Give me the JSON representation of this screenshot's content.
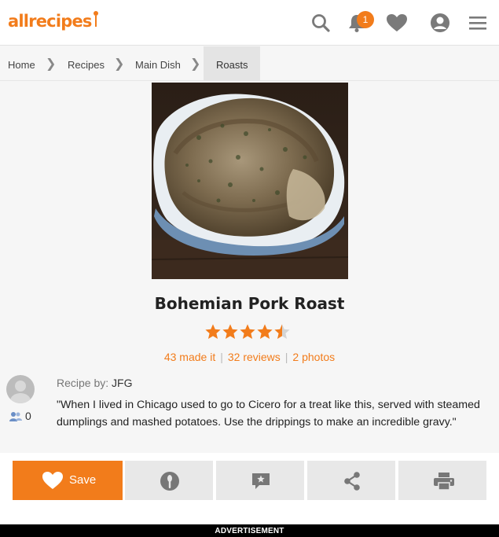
{
  "header": {
    "logo_text": "allrecipes",
    "notification_count": "1",
    "icons": [
      "search-icon",
      "bell-icon",
      "heart-icon",
      "user-icon",
      "menu-icon"
    ],
    "accent_color": "#f27c1b"
  },
  "breadcrumbs": [
    "Home",
    "Recipes",
    "Main Dish",
    "Roasts"
  ],
  "recipe": {
    "title": "Bohemian Pork Roast",
    "rating": 4.5,
    "made_it": "43 made it",
    "reviews": "32 reviews",
    "photos": "2 photos",
    "byline_label": "Recipe by:",
    "author": "JFG",
    "followers": "0",
    "description": "\"When I lived in Chicago used to go to Cicero for a treat like this, served with steamed dumplings and mashed potatoes. Use the drippings to make an incredible gravy.\""
  },
  "actions": {
    "save_label": "Save",
    "buttons": [
      "heart-icon",
      "made-it-icon",
      "review-icon",
      "share-icon",
      "print-icon"
    ]
  },
  "ad_label": "ADVERTISEMENT"
}
